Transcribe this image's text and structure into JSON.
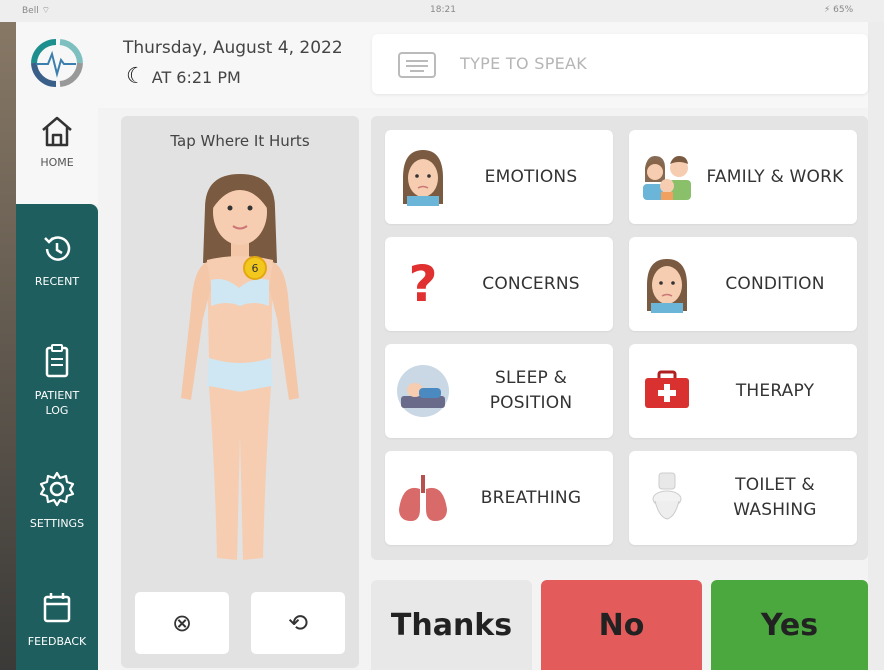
{
  "status": {
    "left": "Bell ⌔",
    "center": "18:21",
    "right": "⚡ 65%"
  },
  "header": {
    "date": "Thursday, August 4, 2022",
    "time": "AT 6:21 PM",
    "speak_placeholder": "TYPE TO SPEAK"
  },
  "nav": {
    "home": "HOME",
    "recent": "RECENT",
    "patient_log_1": "PATIENT",
    "patient_log_2": "LOG",
    "settings": "SETTINGS",
    "feedback": "FEEDBACK"
  },
  "body_panel": {
    "title": "Tap Where It Hurts",
    "pain_marker": "6"
  },
  "categories": [
    {
      "label": "EMOTIONS",
      "icon": "woman-face-icon"
    },
    {
      "label": "FAMILY & WORK",
      "icon": "family-icon"
    },
    {
      "label": "CONCERNS",
      "icon": "question-mark-icon"
    },
    {
      "label": "CONDITION",
      "icon": "dizzy-face-icon"
    },
    {
      "label": "SLEEP & POSITION",
      "icon": "sleep-icon"
    },
    {
      "label": "THERAPY",
      "icon": "first-aid-kit-icon"
    },
    {
      "label": "BREATHING",
      "icon": "lungs-icon"
    },
    {
      "label": "TOILET & WASHING",
      "icon": "toilet-icon"
    }
  ],
  "responses": {
    "thanks": "Thanks",
    "no": "No",
    "yes": "Yes"
  },
  "colors": {
    "sidebar": "#1e5e5e",
    "no": "#e35b5b",
    "yes": "#4aa83e",
    "panel": "#e4e4e4"
  }
}
